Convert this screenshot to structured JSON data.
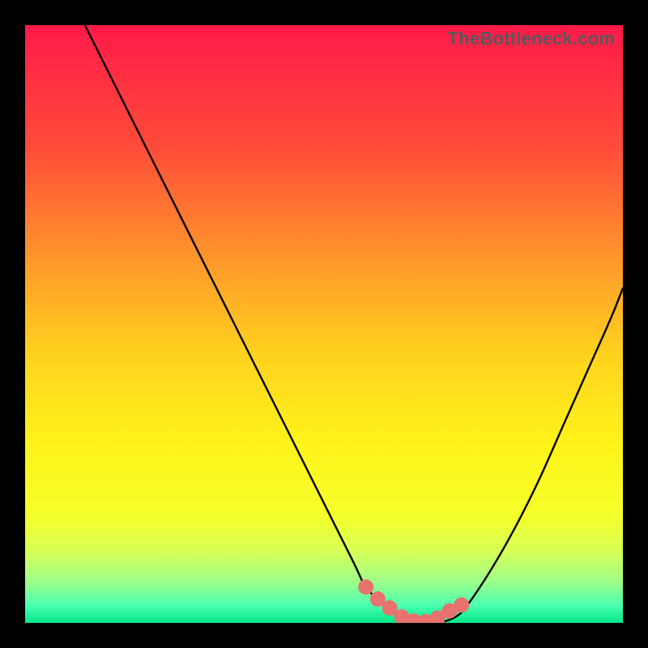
{
  "watermark": "TheBottleneck.com",
  "colors": {
    "gradient_stops": [
      {
        "offset": 0.0,
        "color": "#ff1a49"
      },
      {
        "offset": 0.2,
        "color": "#ff4a3a"
      },
      {
        "offset": 0.4,
        "color": "#ff9a2a"
      },
      {
        "offset": 0.55,
        "color": "#ffd21f"
      },
      {
        "offset": 0.7,
        "color": "#fff31a"
      },
      {
        "offset": 0.82,
        "color": "#f5ff2a"
      },
      {
        "offset": 0.88,
        "color": "#d7ff55"
      },
      {
        "offset": 0.93,
        "color": "#9fff88"
      },
      {
        "offset": 0.97,
        "color": "#4effb0"
      },
      {
        "offset": 1.0,
        "color": "#00e889"
      }
    ],
    "curve_stroke": "#000000",
    "marker_fill": "#e8726e",
    "marker_stroke": "#d85f5b"
  },
  "chart_data": {
    "type": "line",
    "title": "",
    "xlabel": "",
    "ylabel": "",
    "xlim": [
      0,
      100
    ],
    "ylim": [
      0,
      100
    ],
    "grid": false,
    "series": [
      {
        "name": "bottleneck-curve",
        "x": [
          10,
          15,
          20,
          25,
          30,
          35,
          40,
          45,
          50,
          55,
          57,
          60,
          63,
          66,
          69,
          72,
          74,
          78,
          82,
          86,
          90,
          94,
          98,
          100
        ],
        "values": [
          100,
          90,
          80,
          70,
          60,
          50,
          40,
          30,
          20,
          10,
          6,
          3,
          1,
          0,
          0,
          1,
          3,
          9,
          16,
          24,
          33,
          42,
          51,
          56
        ]
      }
    ],
    "markers": {
      "name": "highlighted-range",
      "x": [
        57,
        59,
        61,
        63,
        65,
        67,
        69,
        71,
        73
      ],
      "values": [
        6,
        4,
        2.5,
        1,
        0.3,
        0.2,
        0.8,
        2,
        3
      ]
    }
  }
}
